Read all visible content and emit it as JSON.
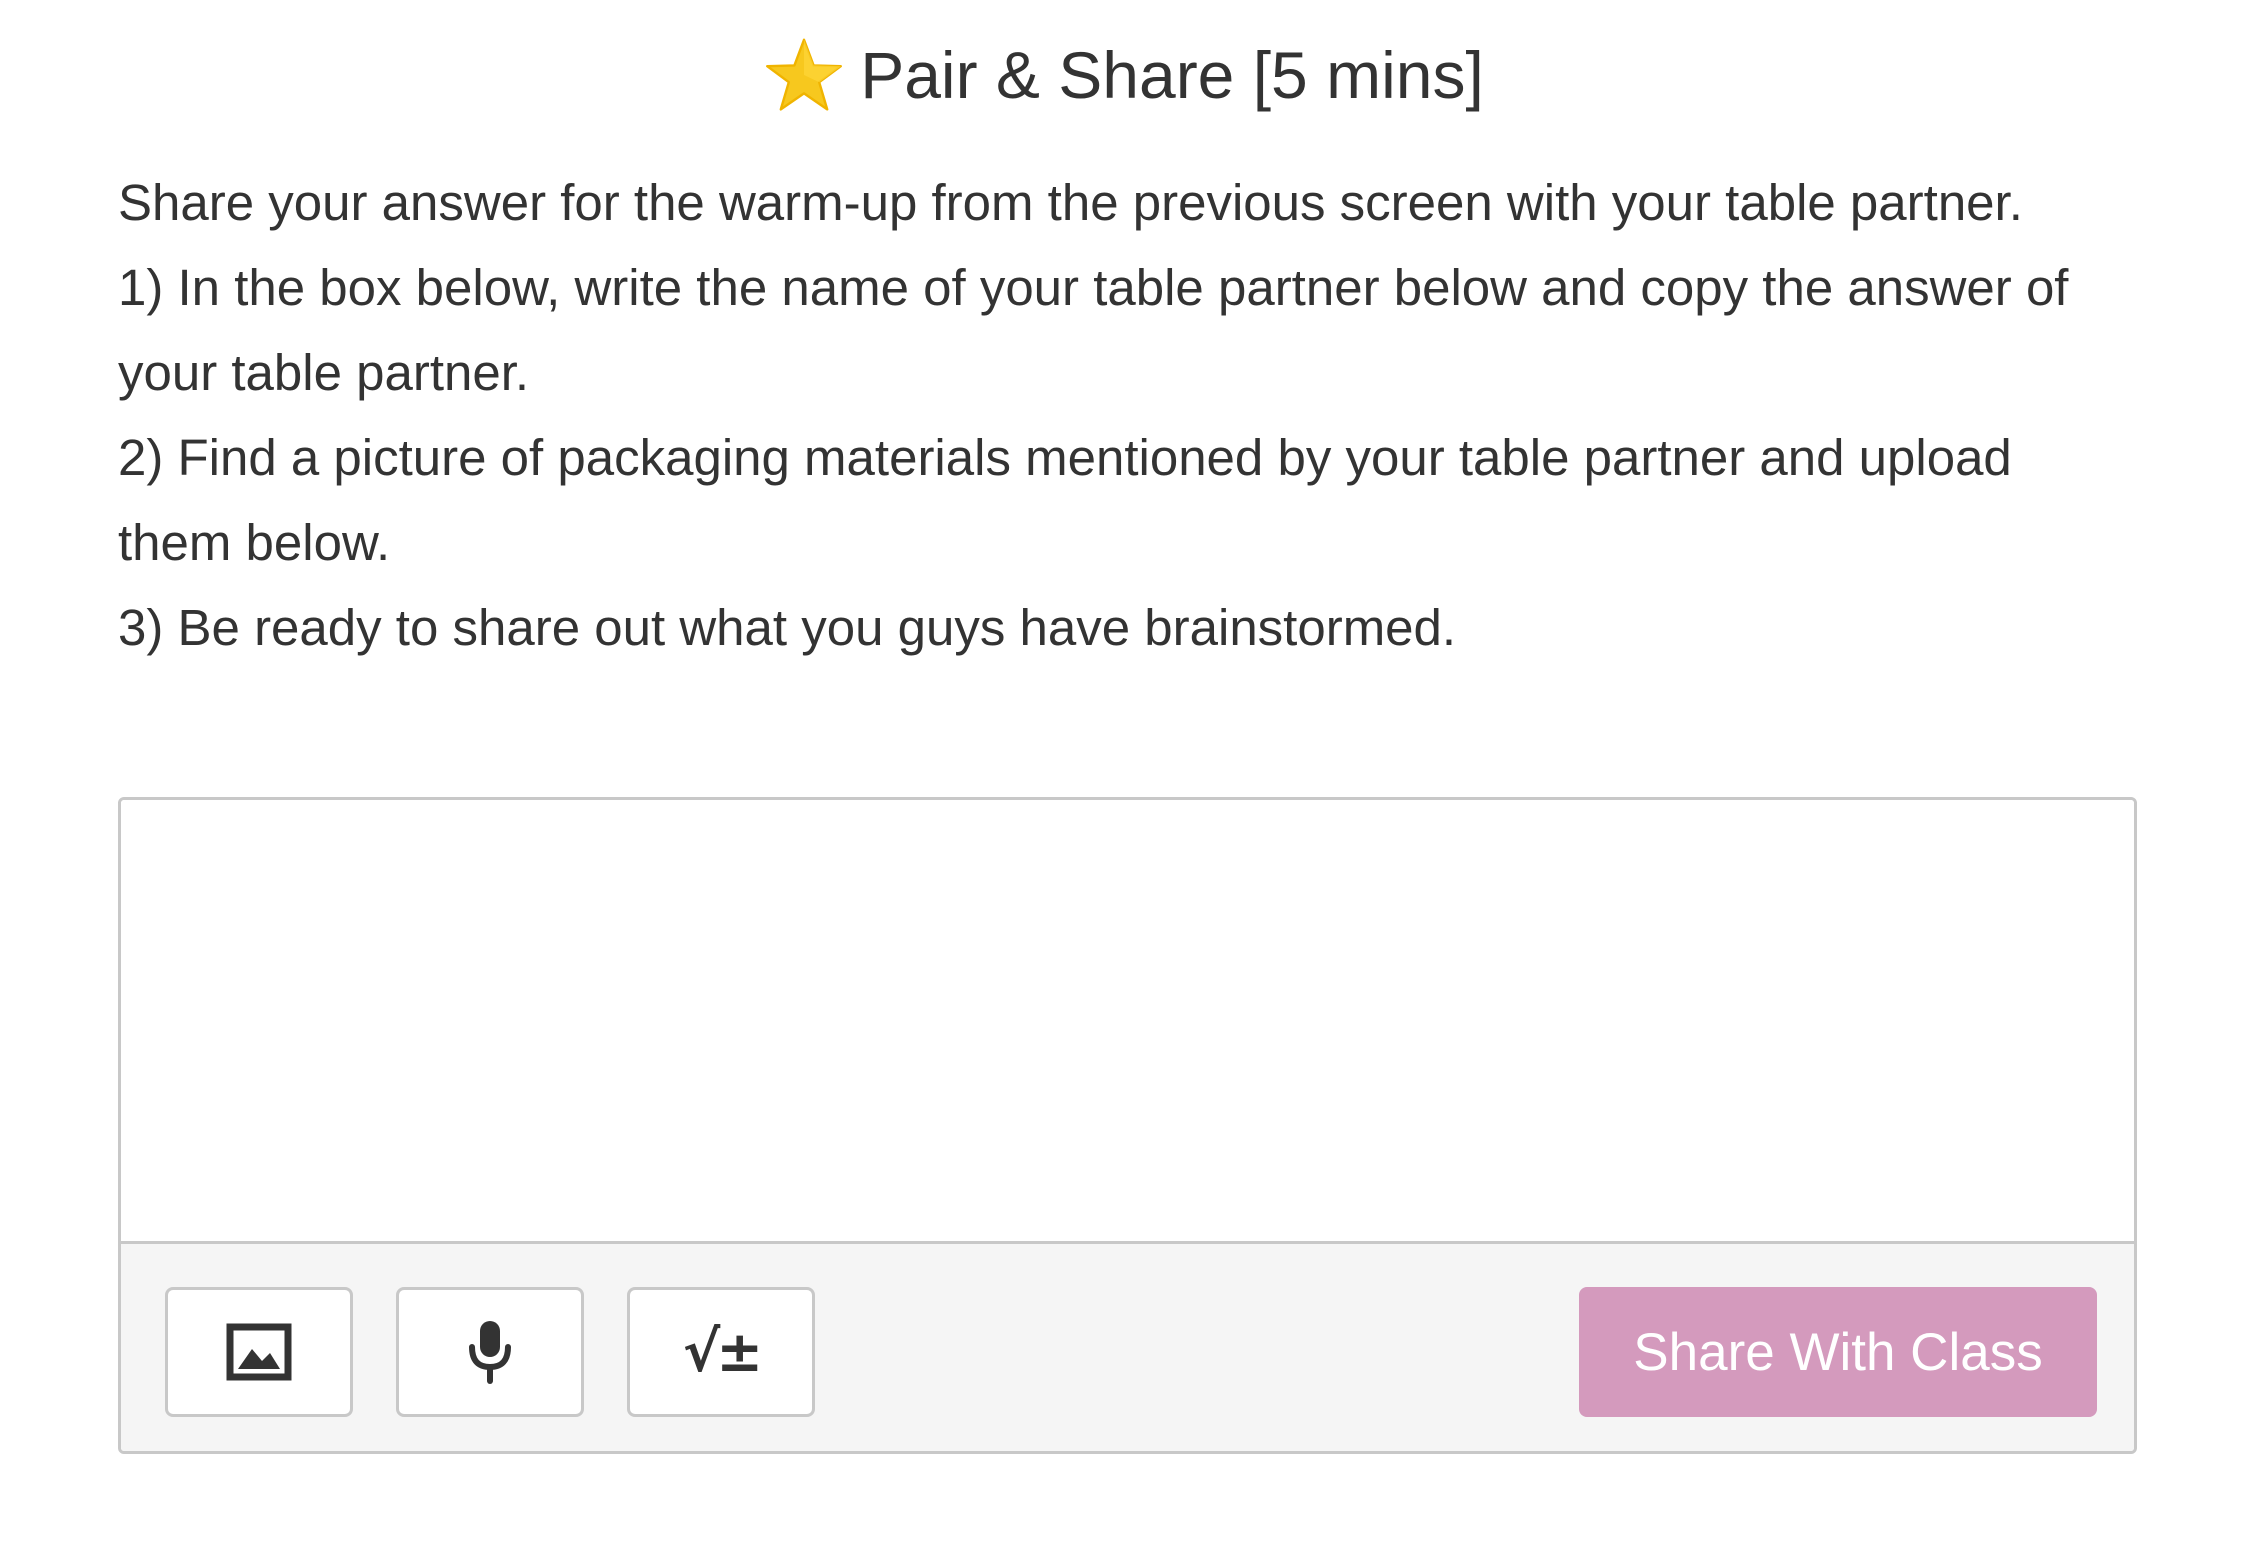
{
  "header": {
    "star_icon": "star-emoji-icon",
    "title": "Pair & Share [5 mins]"
  },
  "instructions": {
    "intro": "Share your answer for the warm-up from the previous screen with your table partner.",
    "step1": "1) In the box below, write the name of your table partner below and copy the answer of your table partner.",
    "step2": "2) Find a picture of packaging materials mentioned by your table partner and upload them below.",
    "step3": "3) Be ready to share out what you guys have brainstormed."
  },
  "response": {
    "value": "",
    "placeholder": ""
  },
  "toolbar": {
    "image_icon": "image-upload-icon",
    "audio_icon": "microphone-icon",
    "math_icon": "math-sqrt-plusminus-icon",
    "math_glyph": "√±",
    "share_label": "Share With Class"
  },
  "colors": {
    "share_button": "#d49abd",
    "toolbar_bg": "#f5f5f5",
    "border": "#c8c8c8",
    "text": "#333333",
    "star": "#f7c81e"
  }
}
